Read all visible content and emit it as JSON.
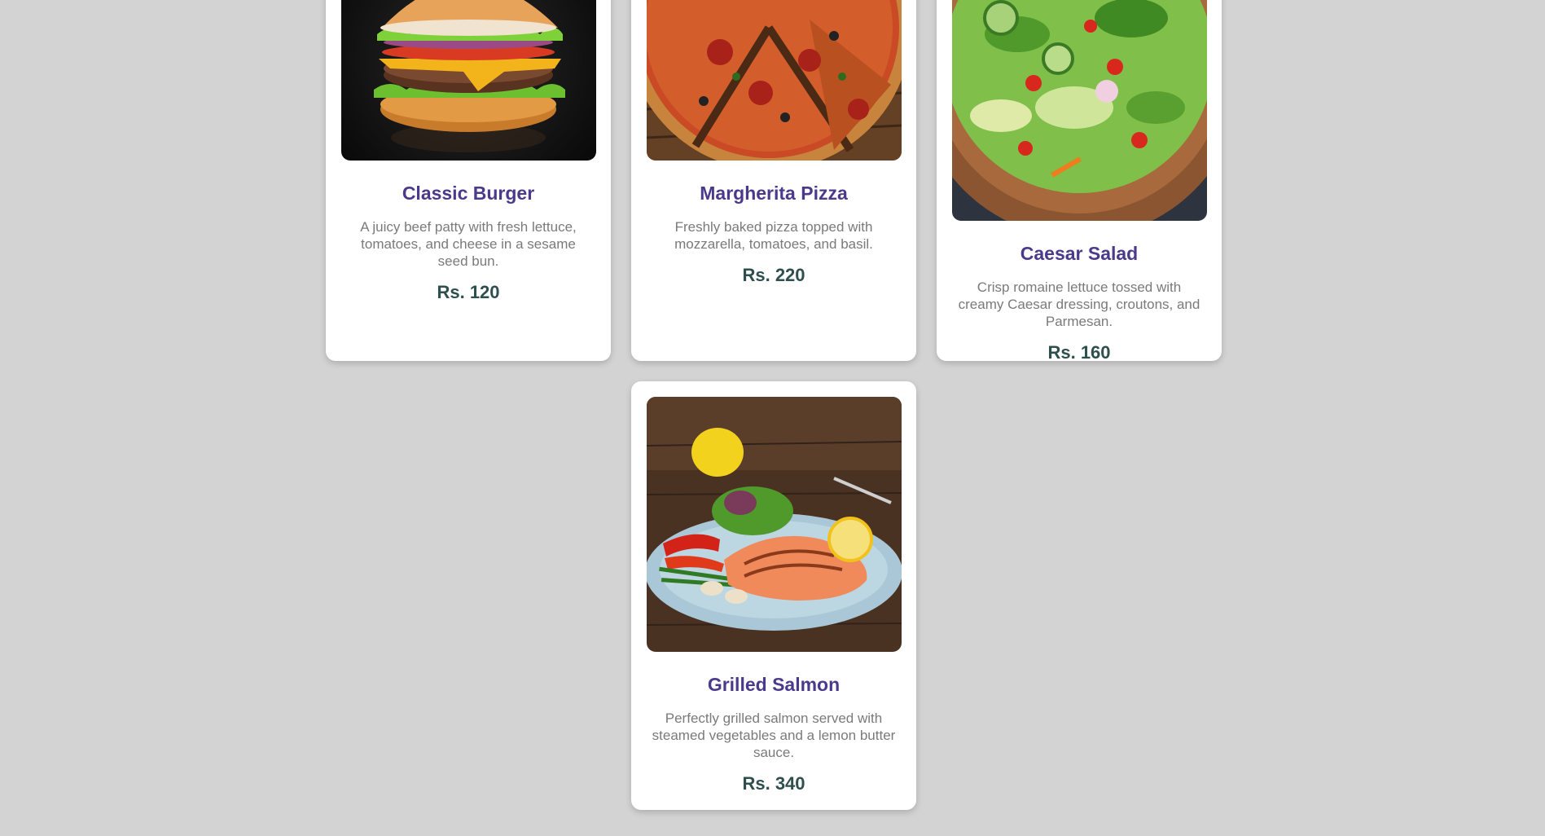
{
  "menu": {
    "items": [
      {
        "title": "Classic Burger",
        "description": "A juicy beef patty with fresh lettuce, tomatoes, and cheese in a sesame seed bun.",
        "price": "Rs. 120",
        "image_icon": "burger-image"
      },
      {
        "title": "Margherita Pizza",
        "description": "Freshly baked pizza topped with mozzarella, tomatoes, and basil.",
        "price": "Rs. 220",
        "image_icon": "pizza-image"
      },
      {
        "title": "Caesar Salad",
        "description": "Crisp romaine lettuce tossed with creamy Caesar dressing, croutons, and Parmesan.",
        "price": "Rs. 160",
        "image_icon": "salad-image"
      },
      {
        "title": "Grilled Salmon",
        "description": "Perfectly grilled salmon served with steamed vegetables and a lemon butter sauce.",
        "price": "Rs. 340",
        "image_icon": "salmon-image"
      }
    ]
  },
  "colors": {
    "background": "#d3d3d3",
    "card": "#ffffff",
    "title": "#4b3a8c",
    "description": "#7a7a7a",
    "price": "#2f4f4f"
  }
}
